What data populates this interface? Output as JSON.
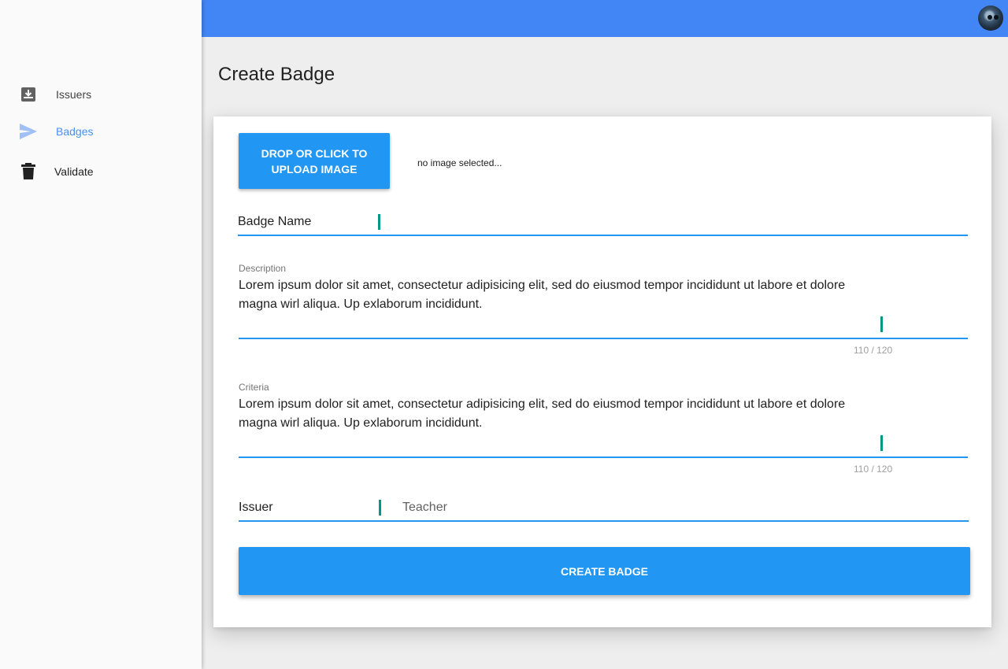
{
  "sidebar": {
    "items": [
      {
        "label": "Issuers",
        "icon": "inbox-download-icon",
        "active": false
      },
      {
        "label": "Badges",
        "icon": "send-icon",
        "active": true
      },
      {
        "label": "Validate",
        "icon": "trash-icon",
        "active": false
      }
    ]
  },
  "header": {
    "avatar_icon": "user-avatar"
  },
  "page": {
    "title": "Create Badge"
  },
  "form": {
    "upload_button_label": "DROP OR CLICK TO UPLOAD IMAGE",
    "image_status": "no image selected...",
    "badge_name": {
      "label": "Badge Name",
      "value": ""
    },
    "description": {
      "label": "Description",
      "value": "Lorem ipsum dolor sit amet, consectetur adipisicing elit, sed do eiusmod tempor incididunt ut labore et dolore magna wirl aliqua. Up exlaborum incididunt.",
      "counter": "110 / 120"
    },
    "criteria": {
      "label": "Criteria",
      "value": "Lorem ipsum dolor sit amet, consectetur adipisicing elit, sed do eiusmod tempor incididunt ut labore et dolore magna wirl aliqua. Up exlaborum incididunt.",
      "counter": "110 / 120"
    },
    "issuer": {
      "label": "Issuer",
      "value": "Teacher"
    },
    "submit_label": "CREATE BADGE"
  },
  "colors": {
    "accent": "#2196f3",
    "appbar": "#4285f4",
    "active_nav": "#4a8ef0",
    "cursor": "#009688"
  }
}
